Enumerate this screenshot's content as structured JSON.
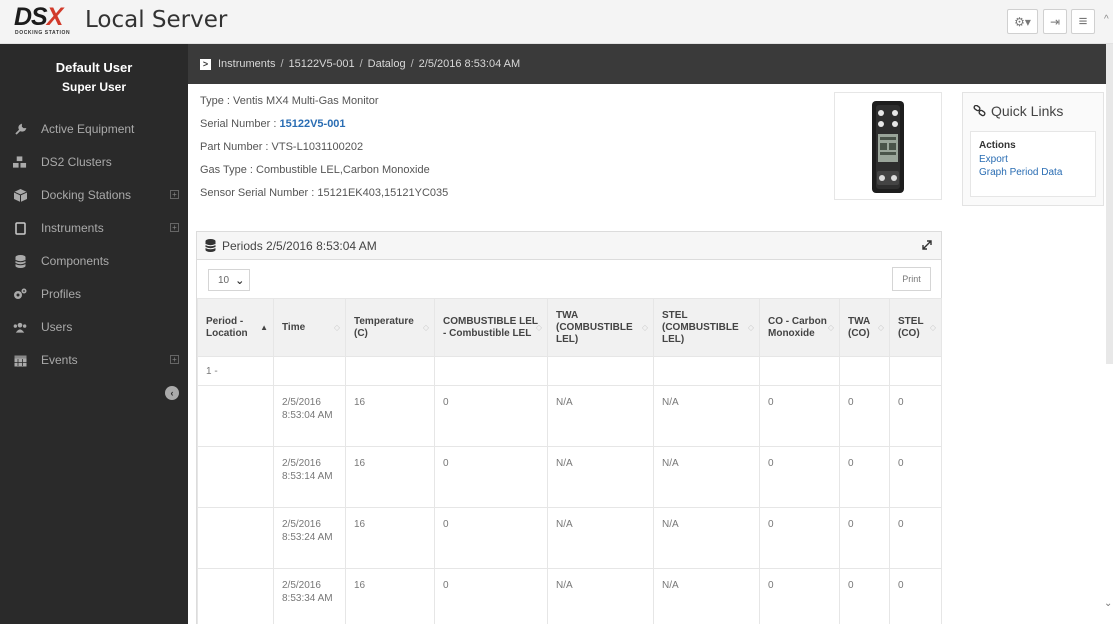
{
  "app": {
    "logo_text": "DSX",
    "logo_subtitle": "DOCKING STATION",
    "title": "Local Server"
  },
  "toolbar": {
    "settings_label": "⚙▾",
    "logout_label": "⇥",
    "menu_label": "≡"
  },
  "sidebar": {
    "user_name": "Default User",
    "user_role": "Super User",
    "items": [
      {
        "label": "Active Equipment",
        "icon": "wrench-icon",
        "expandable": false
      },
      {
        "label": "DS2 Clusters",
        "icon": "cubes-icon",
        "expandable": false
      },
      {
        "label": "Docking Stations",
        "icon": "cube-icon",
        "expandable": true
      },
      {
        "label": "Instruments",
        "icon": "tablet-icon",
        "expandable": true
      },
      {
        "label": "Components",
        "icon": "database-icon",
        "expandable": false
      },
      {
        "label": "Profiles",
        "icon": "cogs-icon",
        "expandable": false
      },
      {
        "label": "Users",
        "icon": "users-icon",
        "expandable": false
      },
      {
        "label": "Events",
        "icon": "calendar-icon",
        "expandable": true
      }
    ]
  },
  "breadcrumb": {
    "items": [
      "Instruments",
      "15122V5-001",
      "Datalog",
      "2/5/2016 8:53:04 AM"
    ]
  },
  "instrument": {
    "type_line": "Type : Ventis MX4 Multi-Gas Monitor",
    "serial_label": "Serial Number : ",
    "serial_value": "15122V5-001",
    "part_line": "Part Number : VTS-L1031100202",
    "gas_line": "Gas Type : Combustible LEL,Carbon Monoxide",
    "sensor_line": "Sensor Serial Number : 15121EK403,15121YC035"
  },
  "quick_links": {
    "title": "Quick Links",
    "actions_label": "Actions",
    "links": [
      "Export",
      "Graph Period Data"
    ]
  },
  "periods": {
    "title": "Periods 2/5/2016 8:53:04 AM",
    "page_size": "10",
    "print_label": "Print",
    "columns": [
      "Period - Location",
      "Time",
      "Temperature (C)",
      "COMBUSTIBLE LEL - Combustible LEL",
      "TWA (COMBUSTIBLE LEL)",
      "STEL (COMBUSTIBLE LEL)",
      "CO - Carbon Monoxide",
      "TWA (CO)",
      "STEL (CO)"
    ],
    "group_label": "1 -",
    "rows": [
      [
        "",
        "2/5/2016 8:53:04 AM",
        "16",
        "0",
        "N/A",
        "N/A",
        "0",
        "0",
        "0"
      ],
      [
        "",
        "2/5/2016 8:53:14 AM",
        "16",
        "0",
        "N/A",
        "N/A",
        "0",
        "0",
        "0"
      ],
      [
        "",
        "2/5/2016 8:53:24 AM",
        "16",
        "0",
        "N/A",
        "N/A",
        "0",
        "0",
        "0"
      ],
      [
        "",
        "2/5/2016 8:53:34 AM",
        "16",
        "0",
        "N/A",
        "N/A",
        "0",
        "0",
        "0"
      ]
    ]
  },
  "colors": {
    "sidebar_bg": "#2a2a2a",
    "breadcrumb_bg": "#3a3a3a",
    "link": "#2a6db3",
    "logo_accent": "#d23a2a"
  }
}
